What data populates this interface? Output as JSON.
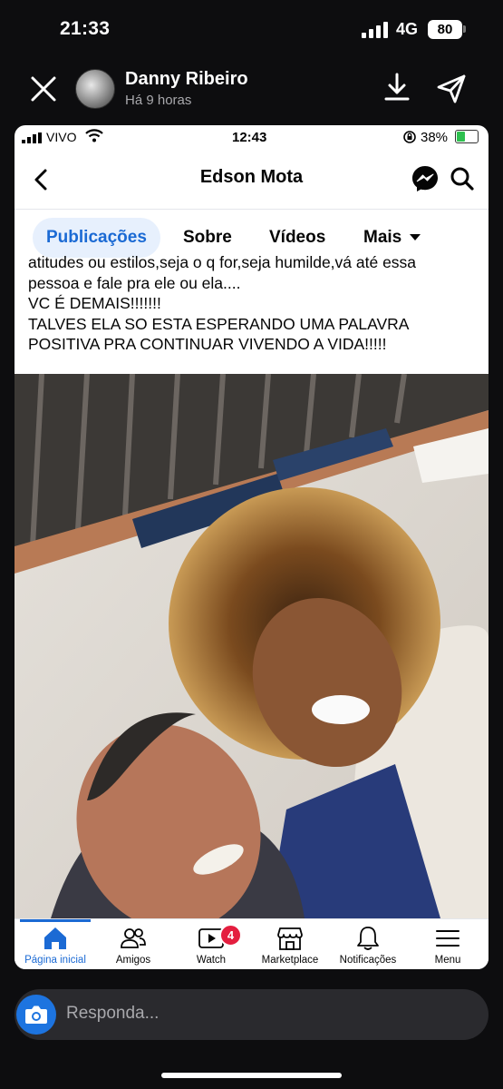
{
  "os_status": {
    "time": "21:33",
    "network": "4G",
    "battery": "80"
  },
  "story": {
    "name": "Danny Ribeiro",
    "time": "Há 9 horas"
  },
  "inner_status": {
    "carrier": "VIVO",
    "time": "12:43",
    "battery": "38%"
  },
  "fb_header": {
    "title": "Edson Mota"
  },
  "tabs": [
    {
      "label": "Publicações",
      "active": true
    },
    {
      "label": "Sobre"
    },
    {
      "label": "Vídeos"
    },
    {
      "label": "Mais"
    }
  ],
  "post": {
    "lines": [
      "atitudes ou estilos,seja o q for,seja humilde,vá até essa",
      "pessoa e fale pra ele ou ela....",
      "VC É DEMAIS!!!!!!!",
      "TALVES ELA SO ESTA ESPERANDO UMA PALAVRA",
      "POSITIVA PRA CONTINUAR VIVENDO A VIDA!!!!!"
    ]
  },
  "bottom_nav": [
    {
      "label": "Página inicial",
      "icon": "home-icon",
      "active": true
    },
    {
      "label": "Amigos",
      "icon": "friends-icon"
    },
    {
      "label": "Watch",
      "icon": "watch-icon",
      "badge": "4"
    },
    {
      "label": "Marketplace",
      "icon": "marketplace-icon"
    },
    {
      "label": "Notificações",
      "icon": "bell-icon"
    },
    {
      "label": "Menu",
      "icon": "menu-icon"
    }
  ],
  "reply": {
    "placeholder": "Responda..."
  },
  "colors": {
    "fb_blue": "#1b6ad4",
    "badge_red": "#e41e3f",
    "camera_blue": "#1d74e0"
  }
}
